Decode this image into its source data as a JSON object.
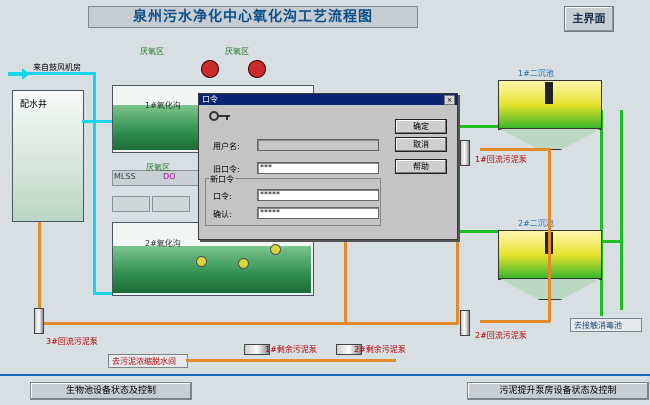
{
  "header": {
    "title": "泉州污水净化中心氧化沟工艺流程图",
    "main_button": "主界面"
  },
  "labels": {
    "anaerobic_top_left": "厌氧区",
    "anaerobic_top_right": "厌氧区",
    "aerobic_left_mid": "厌氧区",
    "inflow": "来自鼓风机房",
    "water_well": "配水井",
    "ox_ditch1": "1#氧化沟",
    "ox_ditch2": "2#氧化沟",
    "mlss": "MLSS",
    "do": "DO",
    "clarifier1": "1#二沉池",
    "clarifier2": "2#二沉池",
    "pump3": "3#回流污泥泵",
    "pump1": "1#回流污泥泵",
    "pump2": "2#回流污泥泵",
    "pump_excess1": "1#剩余污泥泵",
    "pump_excess2": "2#剩余污泥泵",
    "to_dewater": "去污泥浓缩脱水间",
    "to_disinfect": "去接触消毒池"
  },
  "footer": {
    "left": "生物池设备状态及控制",
    "right": "污泥提升泵房设备状态及控制"
  },
  "dialog": {
    "title": "口令",
    "close": "×",
    "username_label": "用户名:",
    "username_value": "",
    "old_pwd_label": "旧口令:",
    "old_pwd_value": "***",
    "new_group_label": "新口令",
    "new_pwd_label": "口令:",
    "new_pwd_value": "*****",
    "confirm_label": "确认:",
    "confirm_value": "*****",
    "ok": "确定",
    "cancel": "取消",
    "help": "帮助"
  }
}
